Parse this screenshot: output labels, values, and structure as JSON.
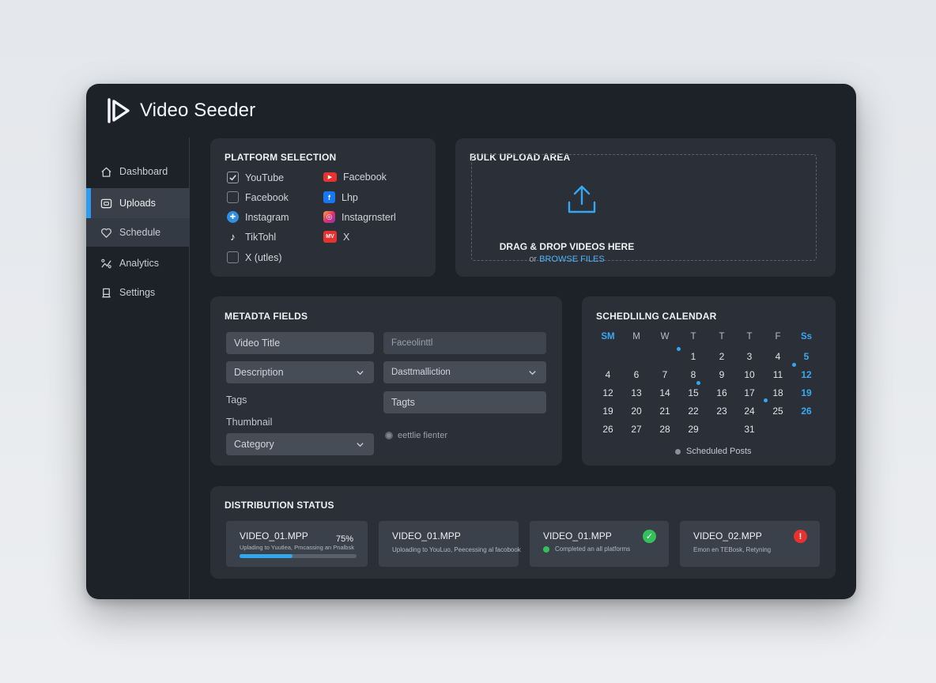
{
  "app": {
    "title": "Video Seeder"
  },
  "sidebar": {
    "items": [
      {
        "label": "Dashboard",
        "icon": "home-icon"
      },
      {
        "label": "Uploads",
        "icon": "upload-box-icon",
        "active": true
      },
      {
        "label": "Schedule",
        "icon": "heart-icon"
      },
      {
        "label": "Analytics",
        "icon": "analytics-icon"
      },
      {
        "label": "Settings",
        "icon": "settings-icon"
      }
    ]
  },
  "platform_selection": {
    "title": "PLATFORM SELECTION",
    "left": [
      {
        "label": "YouTube",
        "checked": true
      },
      {
        "label": "Facebook",
        "checked": false
      },
      {
        "label": "Instagram",
        "icon": "instagram-plus-icon"
      },
      {
        "label": "TikTohl",
        "icon": "tiktok-icon"
      },
      {
        "label": "X (utles)",
        "checked": false
      }
    ],
    "right": [
      {
        "label": "Facebook",
        "icon": "youtube-icon"
      },
      {
        "label": "Lhp",
        "icon": "facebook-icon"
      },
      {
        "label": "Instagrnsterl",
        "icon": "instagram-icon"
      },
      {
        "label": "X",
        "icon": "mv-icon",
        "badge": "MV"
      }
    ]
  },
  "upload": {
    "title": "BULK UPLOAD AREA",
    "drop_text": "DRAG & DROP VIDEOS HERE",
    "browse_prefix": "or",
    "browse_link": "BROWSE FILES"
  },
  "metadata": {
    "title": "METADTA FIELDS",
    "video_title": "Video Title",
    "description": "Description",
    "tags_label": "Tags",
    "thumbnail_label": "Thumbnail",
    "category": "Category",
    "right_field_1": "Faceolinttl",
    "right_field_2": "Dasttmalliction",
    "right_field_3": "Tagts",
    "radio_label": "eettlie fienter"
  },
  "calendar": {
    "title": "SCHEDLILNG CALENDAR",
    "headers": [
      "SM",
      "M",
      "W",
      "T",
      "T",
      "T",
      "F",
      "Ss"
    ],
    "weeks": [
      [
        "",
        "",
        "",
        "1",
        "2",
        "3",
        "4",
        "5"
      ],
      [
        "4",
        "6",
        "7",
        "8",
        "9",
        "10",
        "11",
        "12"
      ],
      [
        "12",
        "13",
        "14",
        "15",
        "16",
        "17",
        "18",
        "19"
      ],
      [
        "19",
        "20",
        "21",
        "22",
        "23",
        "24",
        "25",
        "26"
      ],
      [
        "26",
        "27",
        "28",
        "29",
        "",
        "31",
        "",
        ""
      ]
    ],
    "legend": "Scheduled Posts"
  },
  "distribution": {
    "title": "DISTRIBUTION STATUS",
    "cards": [
      {
        "name": "VIDEO_01.MPP",
        "status": "Uplading to Yuutlea, Pmcassing an Pnalbsk",
        "percent": "75%",
        "progress": 0.45
      },
      {
        "name": "VIDEO_01.MPP",
        "status": "Uploading to YouLuo, Peecessing al facobook"
      },
      {
        "name": "VIDEO_01.MPP",
        "status": "Completed an all platforms",
        "state": "success"
      },
      {
        "name": "VIDEO_02.MPP",
        "status": "Emon  en TEBosk, Retyning",
        "state": "error"
      }
    ]
  },
  "colors": {
    "accent": "#2d9cf0",
    "success": "#34c05a",
    "error": "#e8322f",
    "window_bg": "#1d2128",
    "panel_bg": "#2b3038"
  }
}
